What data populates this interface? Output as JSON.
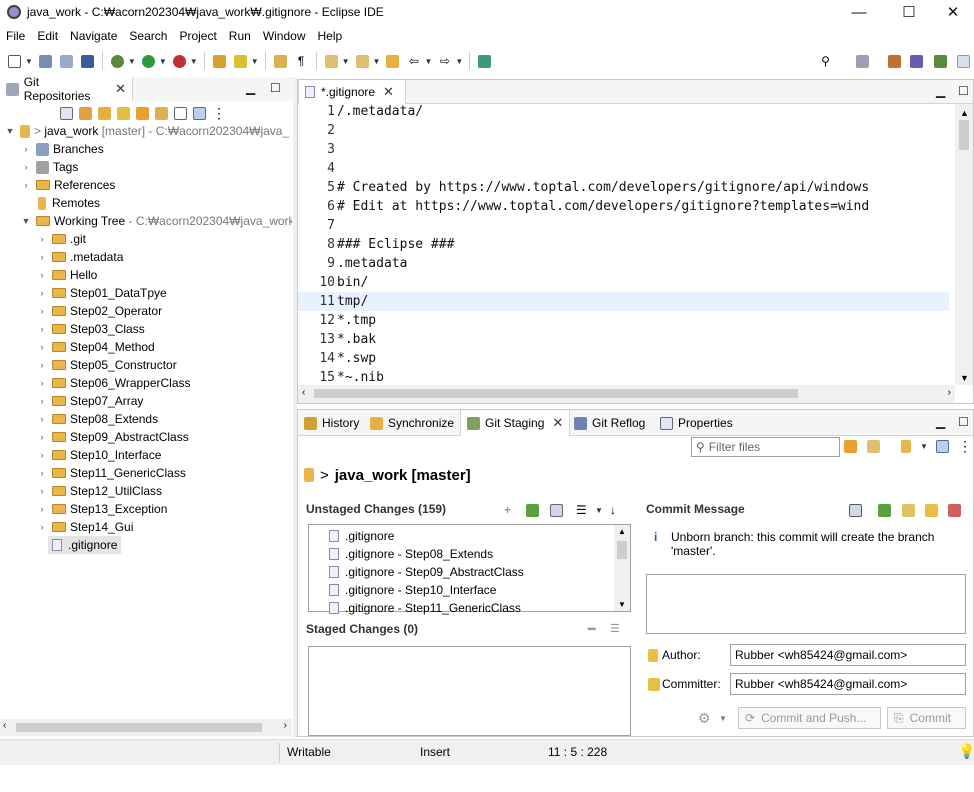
{
  "window": {
    "title": "java_work - C:₩acorn202304₩java_work₩.gitignore - Eclipse IDE",
    "minimize": "—",
    "maximize": "☐",
    "close": "✕"
  },
  "menu": [
    "File",
    "Edit",
    "Navigate",
    "Search",
    "Project",
    "Run",
    "Window",
    "Help"
  ],
  "git_repos": {
    "tab_label": "Git Repositories",
    "repo": {
      "name": "java_work",
      "branch": "[master]",
      "path": "- C:₩acorn202304₩java_"
    },
    "nodes": [
      "Branches",
      "Tags",
      "References",
      "Remotes"
    ],
    "working_tree": {
      "label": "Working Tree",
      "path": "- C:₩acorn202304₩java_work"
    },
    "children": [
      ".git",
      ".metadata",
      "Hello",
      "Step01_DataTpye",
      "Step02_Operator",
      "Step03_Class",
      "Step04_Method",
      "Step05_Constructor",
      "Step06_WrapperClass",
      "Step07_Array",
      "Step08_Extends",
      "Step09_AbstractClass",
      "Step10_Interface",
      "Step11_GenericClass",
      "Step12_UtilClass",
      "Step13_Exception",
      "Step14_Gui"
    ],
    "selected_file": ".gitignore"
  },
  "editor": {
    "tab_label": "*.gitignore",
    "lines": [
      {
        "n": "1",
        "t": "/.metadata/"
      },
      {
        "n": "2",
        "t": ""
      },
      {
        "n": "3",
        "t": ""
      },
      {
        "n": "4",
        "t": ""
      },
      {
        "n": "5",
        "t": "# Created by https://www.toptal.com/developers/gitignore/api/windows"
      },
      {
        "n": "6",
        "t": "# Edit at https://www.toptal.com/developers/gitignore?templates=wind"
      },
      {
        "n": "7",
        "t": ""
      },
      {
        "n": "8",
        "t": "### Eclipse ###"
      },
      {
        "n": "9",
        "t": ".metadata"
      },
      {
        "n": "10",
        "t": "bin/"
      },
      {
        "n": "11",
        "t": "tmp/"
      },
      {
        "n": "12",
        "t": "*.tmp"
      },
      {
        "n": "13",
        "t": "*.bak"
      },
      {
        "n": "14",
        "t": "*.swp"
      },
      {
        "n": "15",
        "t": "*~.nib"
      }
    ],
    "current_line": "11"
  },
  "bottom_tabs": {
    "history": "History",
    "synchronize": "Synchronize",
    "git_staging": "Git Staging",
    "git_reflog": "Git Reflog",
    "properties": "Properties"
  },
  "staging": {
    "filter_placeholder": "Filter files",
    "repo_title": "java_work [master]",
    "unstaged_title": "Unstaged Changes (159)",
    "unstaged": [
      ".gitignore",
      ".gitignore - Step08_Extends",
      ".gitignore - Step09_AbstractClass",
      ".gitignore - Step10_Interface",
      ".gitignore - Step11_GenericClass"
    ],
    "staged_title": "Staged Changes (0)",
    "commit_message_title": "Commit Message",
    "info": "Unborn branch: this commit will create the branch 'master'.",
    "author_label": "Author:",
    "author_value": "Rubber <wh85424@gmail.com>",
    "committer_label": "Committer:",
    "committer_value": "Rubber <wh85424@gmail.com>",
    "commit_push_label": "Commit and Push...",
    "commit_label": "Commit"
  },
  "status": {
    "writable": "Writable",
    "insert": "Insert",
    "position": "11 : 5 : 228"
  }
}
